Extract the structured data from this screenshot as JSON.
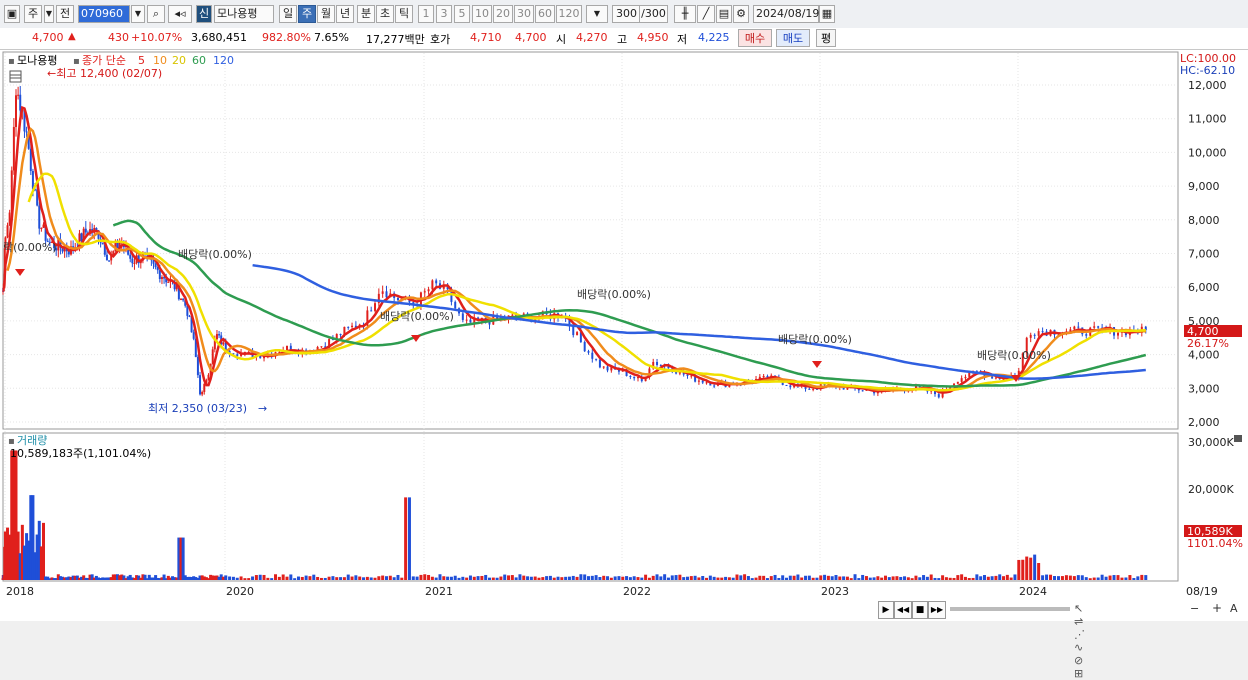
{
  "toolbar": {
    "week": "주",
    "prev": "전",
    "code": "070960",
    "new_badge": "신",
    "stock_name": "모나용평",
    "periods": [
      "일",
      "주",
      "월",
      "년",
      "분",
      "초",
      "틱"
    ],
    "selected_period": "주",
    "nums": [
      "1",
      "3",
      "5",
      "10",
      "20",
      "30",
      "60",
      "120"
    ],
    "count": "300",
    "count_total": "/300",
    "date": "2024/08/19"
  },
  "quote": {
    "price": "4,700",
    "change": "430",
    "change_pct": "+10.07%",
    "volume": "3,680,451",
    "vol_ratio": "982.80%",
    "turnover": "7.65%",
    "amount": "17,277백만",
    "bid_label": "호가",
    "bid1": "4,710",
    "bid2": "4,700",
    "open_label": "시",
    "open": "4,270",
    "high_label": "고",
    "high": "4,950",
    "low_label": "저",
    "low": "4,225",
    "buy": "매수",
    "sell": "매도",
    "eval": "평"
  },
  "chart_data": {
    "type": "line",
    "title": "모나용평",
    "legend": {
      "prefix": "종가 단순",
      "ma": [
        "5",
        "10",
        "20",
        "60",
        "120"
      ],
      "colors": [
        "#e0201c",
        "#f08c1c",
        "#f0e000",
        "#2e9c50",
        "#2f5fe0"
      ]
    },
    "price_axis": {
      "ticks": [
        "12,000",
        "11,000",
        "10,000",
        "9,000",
        "8,000",
        "7,000",
        "6,000",
        "5,000",
        "4,000",
        "3,000",
        "2,000"
      ],
      "lc": "LC:100.00",
      "hc": "HC:-62.10",
      "current": "4,700",
      "current_pct": "26.17%"
    },
    "x_ticks": [
      "2018",
      "2020",
      "2021",
      "2022",
      "2023",
      "2024",
      "08/19"
    ],
    "annotations": {
      "high": "최고 12,400 (02/07)",
      "low": "최저 2,350 (03/23)",
      "div1": "락(0.00%)",
      "div2": "배당락(0.00%)",
      "div3": "배당락(0.00%)",
      "div4": "배당락(0.00%)",
      "div5": "배당락(0.00%)",
      "div6": "배당락(0.00%)"
    },
    "close": [
      [
        2017.85,
        5900
      ],
      [
        2017.95,
        6200
      ],
      [
        2018.05,
        8500
      ],
      [
        2018.1,
        12000
      ],
      [
        2018.2,
        10500
      ],
      [
        2018.3,
        8000
      ],
      [
        2018.4,
        7300
      ],
      [
        2018.5,
        7200
      ],
      [
        2018.6,
        7100
      ],
      [
        2018.75,
        7700
      ],
      [
        2018.85,
        7600
      ],
      [
        2018.95,
        6800
      ],
      [
        2019.05,
        7400
      ],
      [
        2019.15,
        6800
      ],
      [
        2019.25,
        6900
      ],
      [
        2019.35,
        6600
      ],
      [
        2019.45,
        6300
      ],
      [
        2019.55,
        6000
      ],
      [
        2019.65,
        5400
      ],
      [
        2019.72,
        4300
      ],
      [
        2019.78,
        2700
      ],
      [
        2019.85,
        3500
      ],
      [
        2019.92,
        4600
      ],
      [
        2020.0,
        4200
      ],
      [
        2020.1,
        4000
      ],
      [
        2020.2,
        4000
      ],
      [
        2020.3,
        4200
      ],
      [
        2020.4,
        4100
      ],
      [
        2020.5,
        4300
      ],
      [
        2020.6,
        4700
      ],
      [
        2020.7,
        5000
      ],
      [
        2020.78,
        6000
      ],
      [
        2020.85,
        5700
      ],
      [
        2020.95,
        5500
      ],
      [
        2021.05,
        6100
      ],
      [
        2021.12,
        5800
      ],
      [
        2021.2,
        4900
      ],
      [
        2021.3,
        5000
      ],
      [
        2021.45,
        5100
      ],
      [
        2021.55,
        5100
      ],
      [
        2021.7,
        5200
      ],
      [
        2021.8,
        4300
      ],
      [
        2021.9,
        3600
      ],
      [
        2022.0,
        3500
      ],
      [
        2022.1,
        3200
      ],
      [
        2022.15,
        3800
      ],
      [
        2022.25,
        3600
      ],
      [
        2022.35,
        3300
      ],
      [
        2022.5,
        3100
      ],
      [
        2022.6,
        3200
      ],
      [
        2022.75,
        3300
      ],
      [
        2022.85,
        3100
      ],
      [
        2022.95,
        3000
      ],
      [
        2023.05,
        3100
      ],
      [
        2023.15,
        3000
      ],
      [
        2023.3,
        2900
      ],
      [
        2023.4,
        3000
      ],
      [
        2023.5,
        3000
      ],
      [
        2023.6,
        2800
      ],
      [
        2023.7,
        3300
      ],
      [
        2023.8,
        3500
      ],
      [
        2023.9,
        3300
      ],
      [
        2024.0,
        3400
      ],
      [
        2024.05,
        4700
      ]
    ]
  },
  "volume": {
    "label": "거래량",
    "value": "10,589,183주(1,101.04%)",
    "axis": [
      "30,000K",
      "20,000K",
      "10,000K"
    ],
    "current": "10,589K",
    "current_pct": "1101.04%"
  },
  "bottom_controls": [
    "▶",
    "◀◀",
    "■",
    "▶▶",
    "−",
    "+",
    "A"
  ]
}
